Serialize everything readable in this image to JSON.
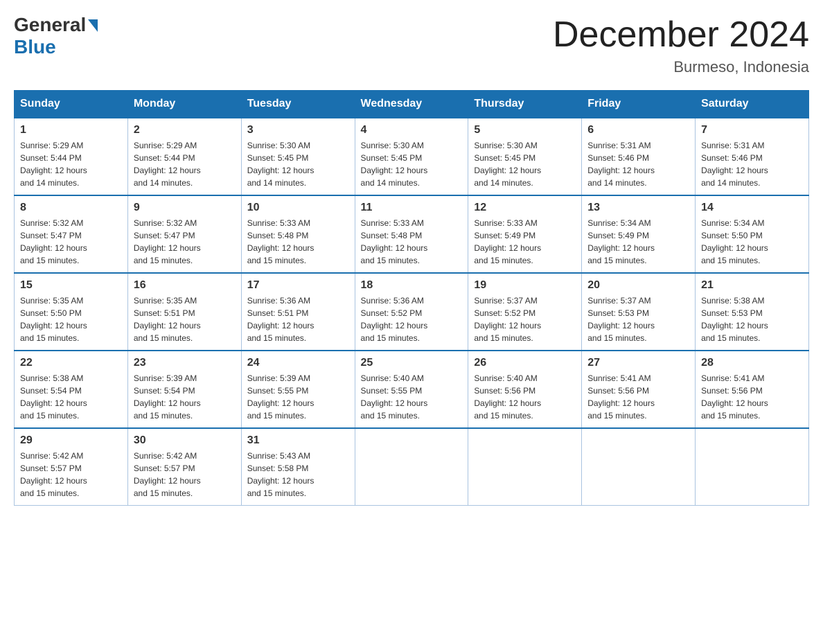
{
  "logo": {
    "general": "General",
    "blue": "Blue"
  },
  "title": "December 2024",
  "location": "Burmeso, Indonesia",
  "weekdays": [
    "Sunday",
    "Monday",
    "Tuesday",
    "Wednesday",
    "Thursday",
    "Friday",
    "Saturday"
  ],
  "weeks": [
    [
      {
        "day": "1",
        "sunrise": "5:29 AM",
        "sunset": "5:44 PM",
        "daylight": "12 hours and 14 minutes."
      },
      {
        "day": "2",
        "sunrise": "5:29 AM",
        "sunset": "5:44 PM",
        "daylight": "12 hours and 14 minutes."
      },
      {
        "day": "3",
        "sunrise": "5:30 AM",
        "sunset": "5:45 PM",
        "daylight": "12 hours and 14 minutes."
      },
      {
        "day": "4",
        "sunrise": "5:30 AM",
        "sunset": "5:45 PM",
        "daylight": "12 hours and 14 minutes."
      },
      {
        "day": "5",
        "sunrise": "5:30 AM",
        "sunset": "5:45 PM",
        "daylight": "12 hours and 14 minutes."
      },
      {
        "day": "6",
        "sunrise": "5:31 AM",
        "sunset": "5:46 PM",
        "daylight": "12 hours and 14 minutes."
      },
      {
        "day": "7",
        "sunrise": "5:31 AM",
        "sunset": "5:46 PM",
        "daylight": "12 hours and 14 minutes."
      }
    ],
    [
      {
        "day": "8",
        "sunrise": "5:32 AM",
        "sunset": "5:47 PM",
        "daylight": "12 hours and 15 minutes."
      },
      {
        "day": "9",
        "sunrise": "5:32 AM",
        "sunset": "5:47 PM",
        "daylight": "12 hours and 15 minutes."
      },
      {
        "day": "10",
        "sunrise": "5:33 AM",
        "sunset": "5:48 PM",
        "daylight": "12 hours and 15 minutes."
      },
      {
        "day": "11",
        "sunrise": "5:33 AM",
        "sunset": "5:48 PM",
        "daylight": "12 hours and 15 minutes."
      },
      {
        "day": "12",
        "sunrise": "5:33 AM",
        "sunset": "5:49 PM",
        "daylight": "12 hours and 15 minutes."
      },
      {
        "day": "13",
        "sunrise": "5:34 AM",
        "sunset": "5:49 PM",
        "daylight": "12 hours and 15 minutes."
      },
      {
        "day": "14",
        "sunrise": "5:34 AM",
        "sunset": "5:50 PM",
        "daylight": "12 hours and 15 minutes."
      }
    ],
    [
      {
        "day": "15",
        "sunrise": "5:35 AM",
        "sunset": "5:50 PM",
        "daylight": "12 hours and 15 minutes."
      },
      {
        "day": "16",
        "sunrise": "5:35 AM",
        "sunset": "5:51 PM",
        "daylight": "12 hours and 15 minutes."
      },
      {
        "day": "17",
        "sunrise": "5:36 AM",
        "sunset": "5:51 PM",
        "daylight": "12 hours and 15 minutes."
      },
      {
        "day": "18",
        "sunrise": "5:36 AM",
        "sunset": "5:52 PM",
        "daylight": "12 hours and 15 minutes."
      },
      {
        "day": "19",
        "sunrise": "5:37 AM",
        "sunset": "5:52 PM",
        "daylight": "12 hours and 15 minutes."
      },
      {
        "day": "20",
        "sunrise": "5:37 AM",
        "sunset": "5:53 PM",
        "daylight": "12 hours and 15 minutes."
      },
      {
        "day": "21",
        "sunrise": "5:38 AM",
        "sunset": "5:53 PM",
        "daylight": "12 hours and 15 minutes."
      }
    ],
    [
      {
        "day": "22",
        "sunrise": "5:38 AM",
        "sunset": "5:54 PM",
        "daylight": "12 hours and 15 minutes."
      },
      {
        "day": "23",
        "sunrise": "5:39 AM",
        "sunset": "5:54 PM",
        "daylight": "12 hours and 15 minutes."
      },
      {
        "day": "24",
        "sunrise": "5:39 AM",
        "sunset": "5:55 PM",
        "daylight": "12 hours and 15 minutes."
      },
      {
        "day": "25",
        "sunrise": "5:40 AM",
        "sunset": "5:55 PM",
        "daylight": "12 hours and 15 minutes."
      },
      {
        "day": "26",
        "sunrise": "5:40 AM",
        "sunset": "5:56 PM",
        "daylight": "12 hours and 15 minutes."
      },
      {
        "day": "27",
        "sunrise": "5:41 AM",
        "sunset": "5:56 PM",
        "daylight": "12 hours and 15 minutes."
      },
      {
        "day": "28",
        "sunrise": "5:41 AM",
        "sunset": "5:56 PM",
        "daylight": "12 hours and 15 minutes."
      }
    ],
    [
      {
        "day": "29",
        "sunrise": "5:42 AM",
        "sunset": "5:57 PM",
        "daylight": "12 hours and 15 minutes."
      },
      {
        "day": "30",
        "sunrise": "5:42 AM",
        "sunset": "5:57 PM",
        "daylight": "12 hours and 15 minutes."
      },
      {
        "day": "31",
        "sunrise": "5:43 AM",
        "sunset": "5:58 PM",
        "daylight": "12 hours and 15 minutes."
      },
      null,
      null,
      null,
      null
    ]
  ],
  "labels": {
    "sunrise": "Sunrise:",
    "sunset": "Sunset:",
    "daylight": "Daylight:"
  }
}
